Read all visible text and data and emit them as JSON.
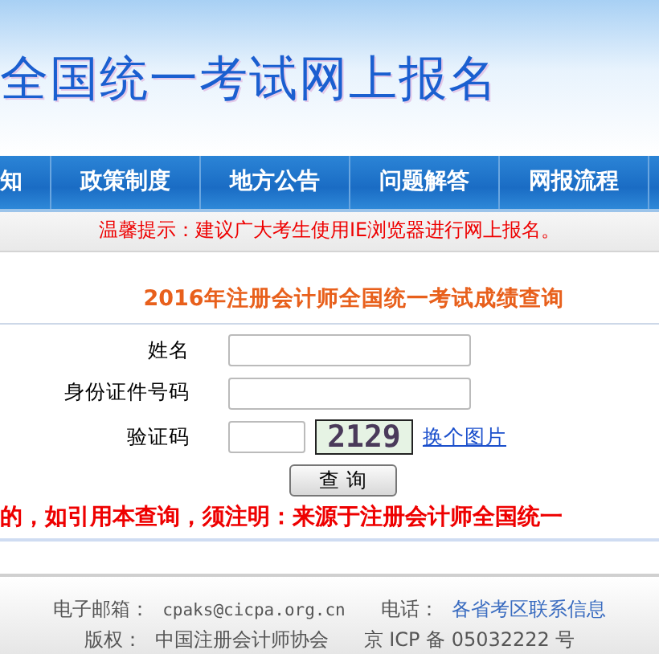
{
  "header": {
    "title": "全国统一考试网上报名"
  },
  "nav": {
    "items": [
      {
        "label": "知"
      },
      {
        "label": "政策制度"
      },
      {
        "label": "地方公告"
      },
      {
        "label": "问题解答"
      },
      {
        "label": "网报流程"
      }
    ]
  },
  "notice": "温馨提示：建议广大考生使用IE浏览器进行网上报名。",
  "form": {
    "heading": "2016年注册会计师全国统一考试成绩查询",
    "fields": [
      {
        "kind": "text",
        "label": "姓名"
      },
      {
        "kind": "text",
        "label": "身份证件号码"
      },
      {
        "kind": "captcha",
        "label": "验证码",
        "code": "2129",
        "link": "换个图片"
      }
    ],
    "submit": "查 询"
  },
  "warning": "的，如引用本查询，须注明：来源于注册会计师全国统一",
  "footer": {
    "lines": [
      {
        "label": "电子邮箱：",
        "value": "cpaks@cicpa.org.cn",
        "label2": "电话：",
        "link": "各省考区联系信息"
      },
      {
        "label": "版权：",
        "value": "中国注册会计师协会",
        "label2": "京 ICP 备 05032222 号"
      }
    ]
  }
}
